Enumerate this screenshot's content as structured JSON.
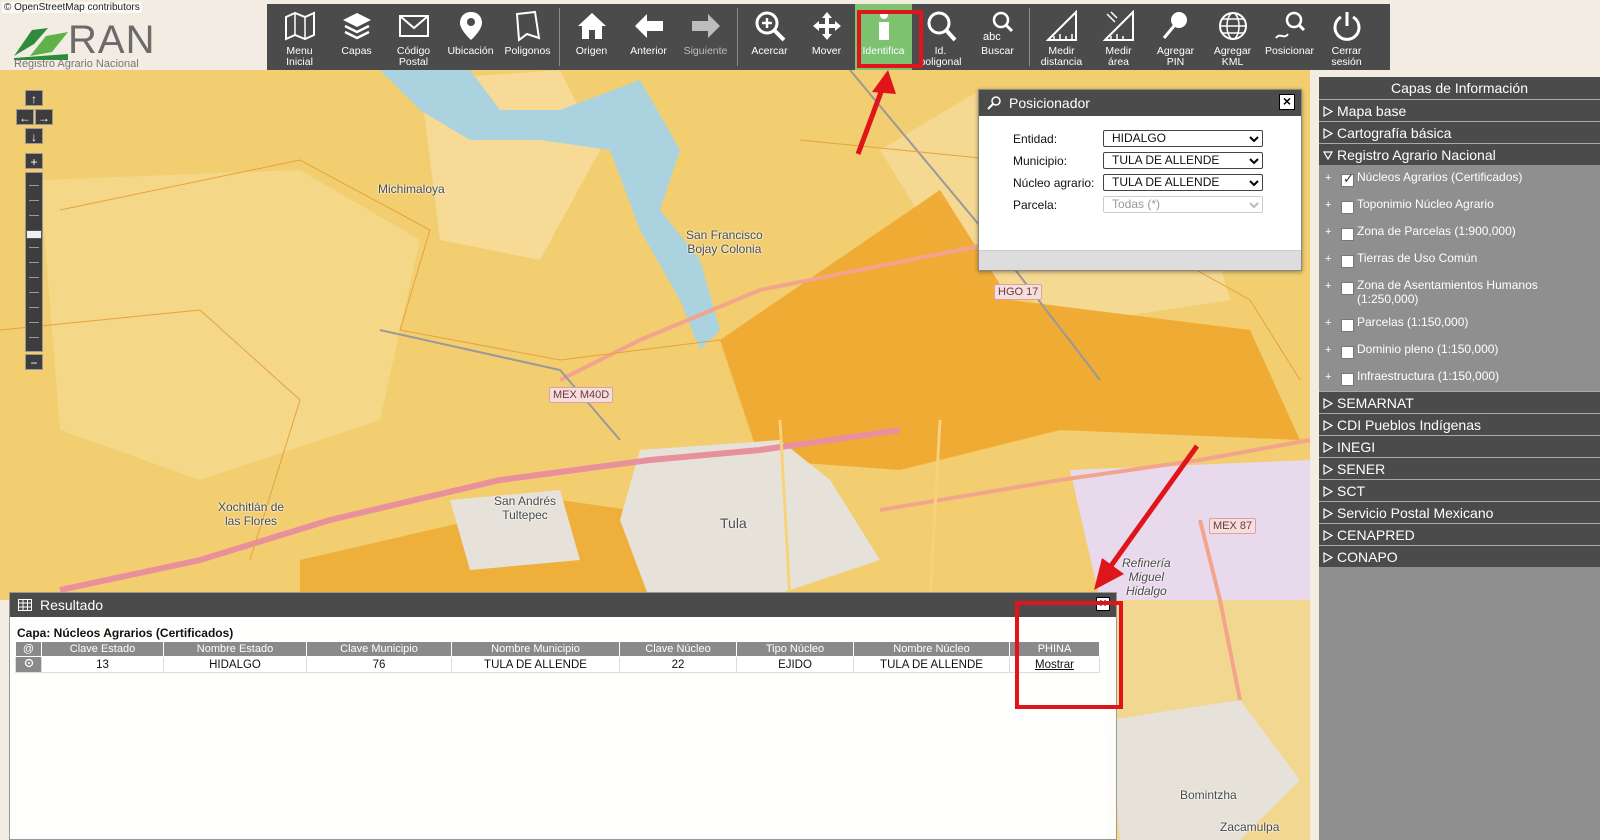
{
  "map": {
    "attribution": "© OpenStreetMap contributors",
    "places": [
      {
        "name": "Michimaloya"
      },
      {
        "name": "San Francisco\nBojay Colonia"
      },
      {
        "name": "Xochitlán de\nlas Flores"
      },
      {
        "name": "San Andrés\nTultepec"
      },
      {
        "name": "Tula"
      },
      {
        "name": "Refinería\nMiguel\nHidalgo"
      },
      {
        "name": "Bomintzha"
      },
      {
        "name": "Zacamulpa"
      }
    ],
    "shields": [
      "HGO 17",
      "MEX M40D",
      "MEX 87"
    ]
  },
  "logo": {
    "title": "RAN",
    "subtitle": "Registro Agrario Nacional"
  },
  "toolbar": {
    "buttons": [
      {
        "label": "Menu\nInicial",
        "icon": "map-icon"
      },
      {
        "label": "Capas",
        "icon": "layers-icon"
      },
      {
        "label": "Código\nPostal",
        "icon": "envelope-icon"
      },
      {
        "label": "Ubicación",
        "icon": "location-pin-icon"
      },
      {
        "label": "Poligonos",
        "icon": "polygon-icon"
      },
      {
        "label": "Origen",
        "icon": "home-icon"
      },
      {
        "label": "Anterior",
        "icon": "arrow-left-icon"
      },
      {
        "label": "Siguiente",
        "icon": "arrow-right-icon"
      },
      {
        "label": "Acercar",
        "icon": "zoom-in-icon"
      },
      {
        "label": "Mover",
        "icon": "move-icon"
      },
      {
        "label": "Identifica",
        "icon": "info-icon"
      },
      {
        "label": "Id.\npoligonal",
        "icon": "magnifier-polygon-icon"
      },
      {
        "label": "Buscar",
        "icon": "search-text-icon"
      },
      {
        "label": "Medir\ndistancia",
        "icon": "ruler-distance-icon"
      },
      {
        "label": "Medir\nárea",
        "icon": "ruler-area-icon"
      },
      {
        "label": "Agregar\nPIN",
        "icon": "pushpin-icon"
      },
      {
        "label": "Agregar\nKML",
        "icon": "globe-icon"
      },
      {
        "label": "Posicionar",
        "icon": "position-icon"
      },
      {
        "label": "Cerrar\nsesión",
        "icon": "power-icon"
      }
    ]
  },
  "posicionador": {
    "title": "Posicionador",
    "fields": [
      {
        "label": "Entidad:",
        "value": "HIDALGO"
      },
      {
        "label": "Municipio:",
        "value": "TULA DE ALLENDE"
      },
      {
        "label": "Núcleo agrario:",
        "value": "TULA DE ALLENDE"
      },
      {
        "label": "Parcela:",
        "value": "Todas (*)"
      }
    ]
  },
  "capas": {
    "title": "Capas de Información",
    "groups_top": [
      "Mapa base",
      "Cartografía básica",
      "Registro Agrario Nacional"
    ],
    "ran_items": [
      {
        "label": "Núcleos Agrarios (Certificados)",
        "checked": true
      },
      {
        "label": "Toponimio Núcleo Agrario",
        "checked": false
      },
      {
        "label": "Zona de Parcelas (1:900,000)",
        "checked": false
      },
      {
        "label": "Tierras de Uso Común",
        "checked": false
      },
      {
        "label": "Zona de Asentamientos Humanos (1:250,000)",
        "checked": false
      },
      {
        "label": "Parcelas (1:150,000)",
        "checked": false
      },
      {
        "label": "Dominio pleno (1:150,000)",
        "checked": false
      },
      {
        "label": "Infraestructura (1:150,000)",
        "checked": false
      }
    ],
    "groups_bottom": [
      "SEMARNAT",
      "CDI Pueblos Indígenas",
      "INEGI",
      "SENER",
      "SCT",
      "Servicio Postal Mexicano",
      "CENAPRED",
      "CONAPO"
    ]
  },
  "resultado": {
    "title": "Resultado",
    "capa": "Capa: Núcleos Agrarios (Certificados)",
    "columns": [
      "@",
      "Clave Estado",
      "Nombre Estado",
      "Clave Municipio",
      "Nombre Municipio",
      "Clave Núcleo",
      "Tipo Núcleo",
      "Nombre Núcleo",
      "PHINA"
    ],
    "rows": [
      [
        "",
        "13",
        "HIDALGO",
        "76",
        "TULA DE ALLENDE",
        "22",
        "EJIDO",
        "TULA DE ALLENDE",
        "Mostrar"
      ]
    ]
  },
  "colors": {
    "panel_dark": "#4b4b4b",
    "active_green": "#7cc270",
    "highlight_red": "#e0141b",
    "polygon_fill": "#f0c14a"
  }
}
